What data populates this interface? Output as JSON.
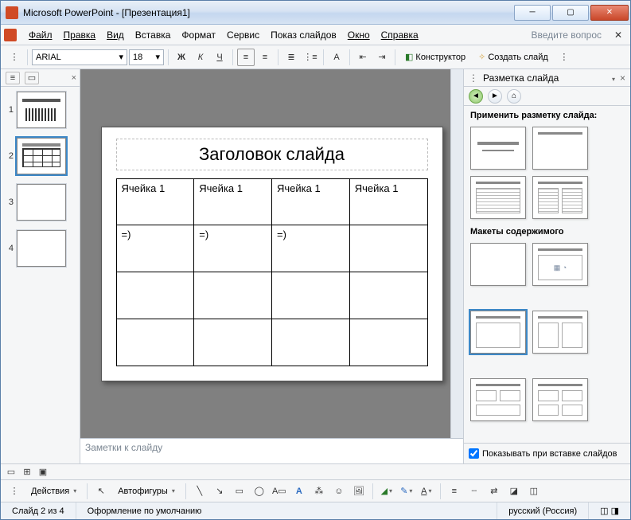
{
  "window": {
    "title": "Microsoft PowerPoint - [Презентация1]"
  },
  "menu": {
    "items": [
      "Файл",
      "Правка",
      "Вид",
      "Вставка",
      "Формат",
      "Сервис",
      "Показ слайдов",
      "Окно",
      "Справка"
    ],
    "hint": "Введите вопрос"
  },
  "toolbar": {
    "font": "ARIAL",
    "size": "18",
    "designer": "Конструктор",
    "new_slide": "Создать слайд"
  },
  "thumbs": {
    "count": 4,
    "active": 2
  },
  "slide": {
    "title": "Заголовок слайда",
    "table": [
      [
        "Ячейка 1",
        "Ячейка 1",
        "Ячейка 1",
        "Ячейка 1"
      ],
      [
        "=)",
        "=)",
        "=)",
        ""
      ],
      [
        "",
        "",
        "",
        ""
      ],
      [
        "",
        "",
        "",
        ""
      ]
    ]
  },
  "notes_placeholder": "Заметки к слайду",
  "taskpane": {
    "title": "Разметка слайда",
    "apply_label": "Применить разметку слайда:",
    "section2": "Макеты содержимого",
    "footer_checkbox": "Показывать при вставке слайдов"
  },
  "bottom": {
    "actions": "Действия",
    "autoshapes": "Автофигуры"
  },
  "status": {
    "slide": "Слайд 2 из 4",
    "design": "Оформление по умолчанию",
    "lang": "русский (Россия)"
  }
}
